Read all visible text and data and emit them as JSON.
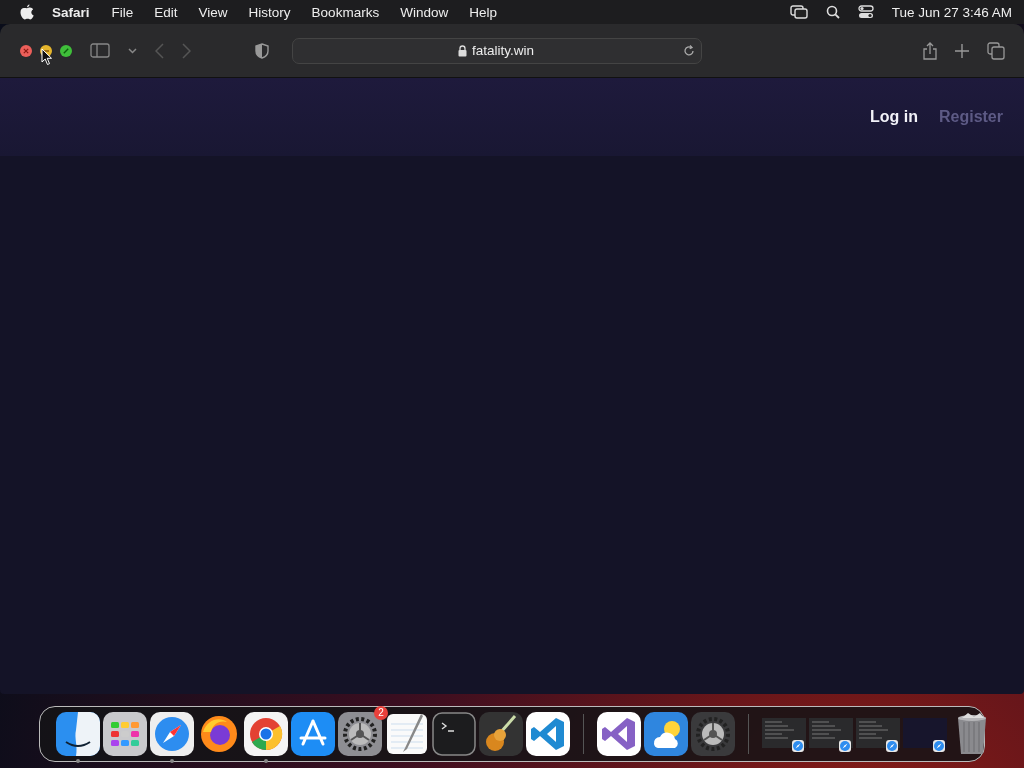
{
  "menu_bar": {
    "app_name": "Safari",
    "items": [
      "File",
      "Edit",
      "View",
      "History",
      "Bookmarks",
      "Window",
      "Help"
    ],
    "clock": "Tue Jun 27  3:46 AM"
  },
  "toolbar": {
    "url": "fatality.win",
    "back_disabled": true,
    "forward_disabled": true
  },
  "page": {
    "nav": [
      {
        "label": "Log in",
        "highlighted": true
      },
      {
        "label": "Register",
        "highlighted": false
      }
    ]
  },
  "dock": {
    "items": [
      {
        "kind": "finder",
        "running": true
      },
      {
        "kind": "launchpad",
        "running": false
      },
      {
        "kind": "safari",
        "running": true
      },
      {
        "kind": "firefox",
        "running": false
      },
      {
        "kind": "chrome",
        "running": true
      },
      {
        "kind": "appstore",
        "running": false
      },
      {
        "kind": "settings",
        "running": false,
        "badge": "2"
      },
      {
        "kind": "textedit",
        "running": false
      },
      {
        "kind": "terminal",
        "running": false
      },
      {
        "kind": "guitar",
        "running": false
      },
      {
        "kind": "vscode",
        "running": false
      },
      {
        "kind": "separator"
      },
      {
        "kind": "visualstudio",
        "running": false
      },
      {
        "kind": "weather",
        "running": false
      },
      {
        "kind": "gear",
        "running": false
      },
      {
        "kind": "separator"
      },
      {
        "kind": "window"
      },
      {
        "kind": "window"
      },
      {
        "kind": "window"
      },
      {
        "kind": "window_blank"
      },
      {
        "kind": "trash"
      }
    ]
  }
}
